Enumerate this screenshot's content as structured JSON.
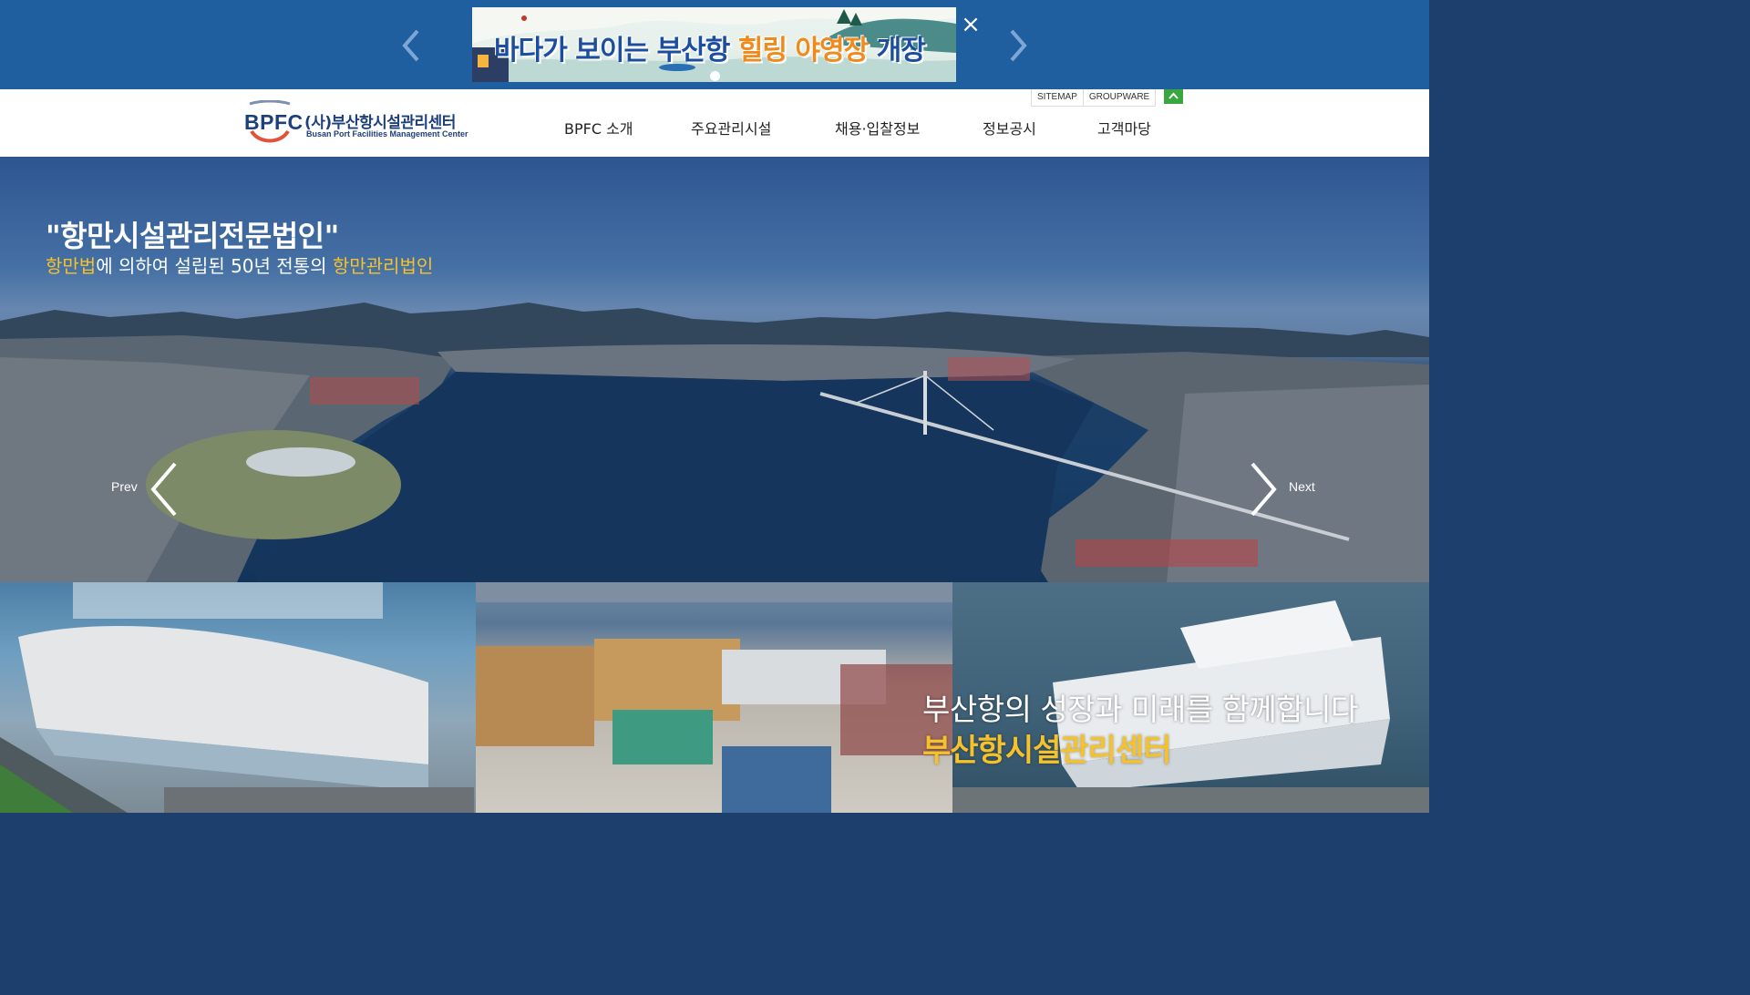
{
  "popup_banner": {
    "text_prefix": "바다가 보이는 부산항 ",
    "text_highlight": "힐링 야영장",
    "text_suffix": " 개장",
    "close_label": "×",
    "prev_icon": "chevron-left-icon",
    "next_icon": "chevron-right-icon",
    "colors": {
      "bar": "#1f5fa0",
      "text": "#1c4ea0",
      "highlight": "#f18a1c"
    }
  },
  "header": {
    "logo": {
      "mark": "BPFC",
      "name_ko": "(사)부산항시설관리센터",
      "name_en": "Busan Port Facilities Management Center"
    },
    "utility_links": [
      "SITEMAP",
      "GROUPWARE"
    ],
    "top_button_icon": "arrow-up-icon",
    "nav": [
      "BPFC 소개",
      "주요관리시설",
      "채용·입찰정보",
      "정보공시",
      "고객마당"
    ]
  },
  "hero": {
    "title": "\"항만시설관리전문법인\"",
    "sub_part1": "항만법",
    "sub_part2": "에 의하여 설립된 50년 전통의 ",
    "sub_part3": "항만관리법인",
    "prev_label": "Prev",
    "next_label": "Next",
    "colors": {
      "accent": "#f6c22b"
    }
  },
  "bottom": {
    "slogan_line1": "부산항의 성장과 미래를 함께합니다",
    "slogan_line2": "부산항시설관리센터"
  }
}
